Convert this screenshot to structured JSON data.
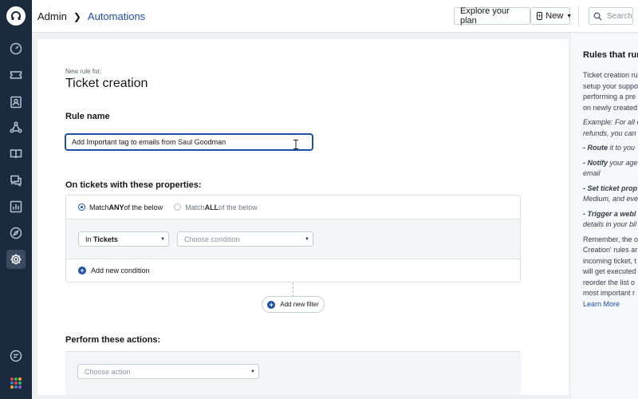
{
  "rail": {
    "apps_colors": [
      "#e8463d",
      "#2bb673",
      "#f5a623",
      "#3b7dd8",
      "#e8463d",
      "#2bb673",
      "#f5a623",
      "#3b7dd8",
      "#8e5bd8"
    ]
  },
  "header": {
    "breadcrumb_root": "Admin",
    "breadcrumb_current": "Automations",
    "explore_label": "Explore your plan",
    "new_label": "New",
    "search_placeholder": "Search"
  },
  "form": {
    "subtitle": "New rule for:",
    "title": "Ticket creation",
    "rule_name_label": "Rule name",
    "rule_name_value": "Add Important tag to emails from Saul Goodman",
    "properties_label": "On tickets with these properties:",
    "match_any_prefix": "Match ",
    "match_any_bold": "ANY",
    "match_any_suffix": " of the below",
    "match_all_prefix": "Match ",
    "match_all_bold": "ALL",
    "match_all_suffix": " of the below",
    "scope_prefix": "In ",
    "scope_value": "Tickets",
    "condition_placeholder": "Choose condition",
    "add_condition_label": "Add new condition",
    "add_filter_label": "Add new filter",
    "actions_label": "Perform these actions:",
    "action_placeholder": "Choose action"
  },
  "help": {
    "title": "Rules that run",
    "p1": [
      "Ticket creation ru",
      "setup your suppo",
      "performing a pre",
      "on newly created"
    ],
    "example": [
      "Example: For all e",
      "refunds, you can"
    ],
    "route_bold": "- Route",
    "route_rest": " it to you",
    "notify_bold": "- Notify",
    "notify_rest": " your age",
    "notify_line2": "email",
    "set_bold": "- Set ticket prop",
    "set_line2": "Medium, and eve",
    "trigger_bold": "- Trigger a webl",
    "trigger_line2": "details in your bil",
    "p3": [
      "Remember, the o",
      "Creation' rules ar",
      "incoming ticket, t",
      "will get executed",
      "reorder the list o",
      "most important r"
    ],
    "learn_more": "Learn More"
  }
}
